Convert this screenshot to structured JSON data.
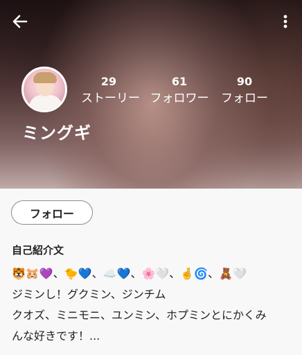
{
  "header": {
    "back_icon": "arrow-left-icon",
    "menu_icon": "more-vertical-icon"
  },
  "profile": {
    "name": "ミングギ",
    "stats": [
      {
        "value": "29",
        "label": "ストーリー"
      },
      {
        "value": "61",
        "label": "フォロワー"
      },
      {
        "value": "90",
        "label": "フォロー"
      }
    ]
  },
  "actions": {
    "follow_label": "フォロー"
  },
  "bio": {
    "title": "自己紹介文",
    "lines": [
      "🐯🐹💜、🐤💙、☁️💙、🌸🤍、🤞🌀、🧸🤍",
      "ジミンし！グクミン、ジンチム",
      "クオズ、ミニモニ、ユンミン、ホプミンとにかくみ",
      "んな好きです！..."
    ]
  }
}
